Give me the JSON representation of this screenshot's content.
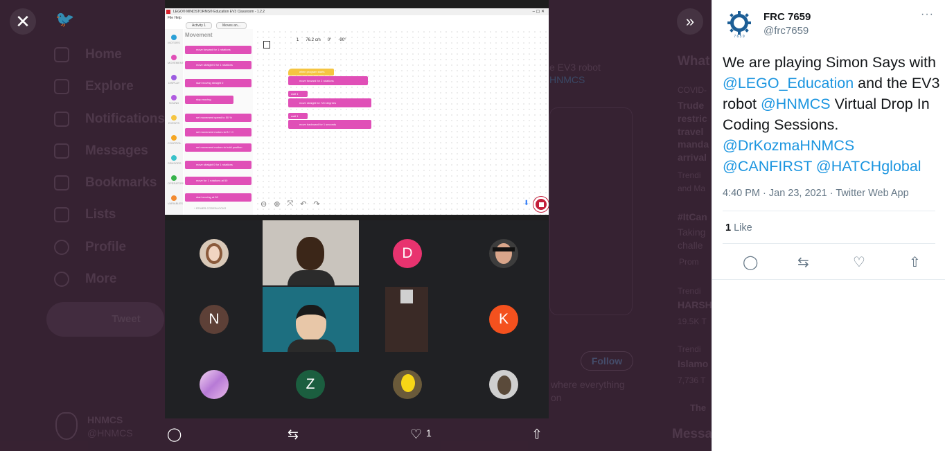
{
  "background": {
    "nav": [
      "Home",
      "Explore",
      "Notifications",
      "Messages",
      "Bookmarks",
      "Lists",
      "Profile",
      "More"
    ],
    "tweet_button": "Tweet",
    "account_name": "HNMCS",
    "account_handle": "@HNMCS",
    "ghost_text_1": "e EV3 robot",
    "ghost_text_2": "HNMCS",
    "right_col": {
      "header": "What",
      "item1_category": "COVID-",
      "item1_lines": [
        "Trude",
        "restric",
        "travel",
        "manda",
        "arrival"
      ],
      "trending1": "Trendi",
      "and_ma": "and Ma",
      "hashtag": "#ItCan",
      "taking": "Taking",
      "challe": "challe",
      "promo": "Prom",
      "trending2": "Trendi",
      "harsh": "HARSH",
      "harsh_count": "19.5K T",
      "trending3": "Trendi",
      "islamo": "Islamo",
      "islamo_count": "7,736 T",
      "the": "The",
      "follow": "Follow",
      "where_text": "where everything",
      "on_text": "on"
    },
    "messages": "Messa"
  },
  "media": {
    "ev3": {
      "window_title": "LEGO® MINDSTORMS® Education EV3 Classroom - 1.2.2",
      "window_controls": "–  ▢  ✕",
      "menu": "File   Help",
      "tabs": [
        "Activity 1",
        "Moves an..."
      ],
      "palette_title": "Movement",
      "categories": [
        "MOTORS",
        "MOVEMENT",
        "DISPLAY",
        "SOUND",
        "EVENTS",
        "CONTROL",
        "SENSORS",
        "OPERATORS",
        "VARIABLES"
      ],
      "category_colors": [
        "#2a9fd6",
        "#e04fb7",
        "#9c5ce0",
        "#b05ce0",
        "#f5c542",
        "#f5a623",
        "#39c1c9",
        "#36b24a",
        "#f28a30"
      ],
      "palette_blocks": [
        "move forward for 1 rotations",
        "move straight 0 for 1 rotations",
        "start moving straight 0",
        "stop moving",
        "set movement speed to 50 %",
        "set movement motors to B + C",
        "set movement motors to hold position",
        "move straight 0 for 1 rotations",
        "move for 1 rotations at 50",
        "start moving at 50"
      ],
      "program_start": "when program starts",
      "program_blocks": [
        "move forward for 2 rotations",
        "wait 1 seconds",
        "move straight for 720 degrees",
        "wait 1 seconds",
        "move backward for 1 seconds"
      ],
      "ports": [
        "1",
        "76.2 cm",
        "0°",
        "-90°"
      ],
      "fewer": "^  FEWER CODEBLOCKS",
      "tools": [
        "⊖",
        "⊕",
        "⤧",
        "↶",
        "↷"
      ]
    },
    "participants": [
      {
        "initial": "D",
        "color": "#e8336f"
      },
      {
        "initial": "N",
        "color": "#5d4037"
      },
      {
        "initial": "K",
        "color": "#f4511e"
      },
      {
        "initial": "Z",
        "color": "#1b5e3f"
      }
    ],
    "actions": {
      "reply_icon": "speech-bubble",
      "retweet_icon": "retweet",
      "like_icon": "heart",
      "like_count": "1",
      "share_icon": "share"
    }
  },
  "tweet": {
    "author_name": "FRC 7659",
    "author_handle": "@frc7659",
    "more": "···",
    "text_parts": [
      {
        "t": "We are playing Simon Says with ",
        "link": false
      },
      {
        "t": "@LEGO_Education",
        "link": true
      },
      {
        "t": " and the EV3 robot ",
        "link": false
      },
      {
        "t": "@HNMCS",
        "link": true
      },
      {
        "t": " Virtual Drop In Coding Sessions. ",
        "link": false
      },
      {
        "t": "@DrKozmaHNMCS",
        "link": true
      },
      {
        "t": " ",
        "link": false
      },
      {
        "t": "@CANFIRST",
        "link": true
      },
      {
        "t": " ",
        "link": false
      },
      {
        "t": "@HATCHglobal",
        "link": true
      }
    ],
    "timestamp": "4:40 PM · Jan 23, 2021 · Twitter Web App",
    "like_count": "1",
    "like_label": "Like",
    "link_color": "#1b95e0"
  }
}
